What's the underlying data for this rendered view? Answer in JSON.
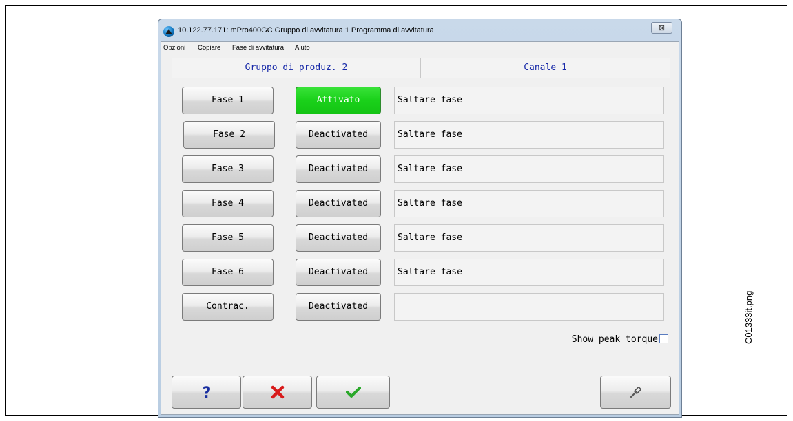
{
  "window": {
    "title": "10.122.77.171: mPro400GC Gruppo di avvitatura 1 Programma di avvitatura",
    "close_glyph": "⊠"
  },
  "menu": [
    "Opzioni",
    "Copiare",
    "Fase di avvitatura",
    "Aiuto"
  ],
  "header": {
    "group": "Gruppo di produz.  2",
    "channel": "Canale 1"
  },
  "rows": [
    {
      "phase": "Fase 1",
      "state": "Attivato",
      "active": true,
      "desc": "Saltare fase"
    },
    {
      "phase": "Fase 2",
      "state": "Deactivated",
      "active": false,
      "desc": "Saltare fase"
    },
    {
      "phase": "Fase 3",
      "state": "Deactivated",
      "active": false,
      "desc": "Saltare fase"
    },
    {
      "phase": "Fase 4",
      "state": "Deactivated",
      "active": false,
      "desc": "Saltare fase"
    },
    {
      "phase": "Fase 5",
      "state": "Deactivated",
      "active": false,
      "desc": "Saltare fase"
    },
    {
      "phase": "Fase 6",
      "state": "Deactivated",
      "active": false,
      "desc": "Saltare fase"
    },
    {
      "phase": "Contrac.",
      "state": "Deactivated",
      "active": false,
      "desc": ""
    }
  ],
  "options": {
    "show_peak_torque": "Show peak torque",
    "checked": false
  },
  "icons": {
    "help": "question-mark-icon",
    "cancel": "red-x-icon",
    "ok": "green-check-icon",
    "tool": "screwdriver-icon"
  },
  "colors": {
    "active_green": "#1ad11a",
    "header_blue": "#1628a8"
  },
  "caption": "C01333it.png"
}
